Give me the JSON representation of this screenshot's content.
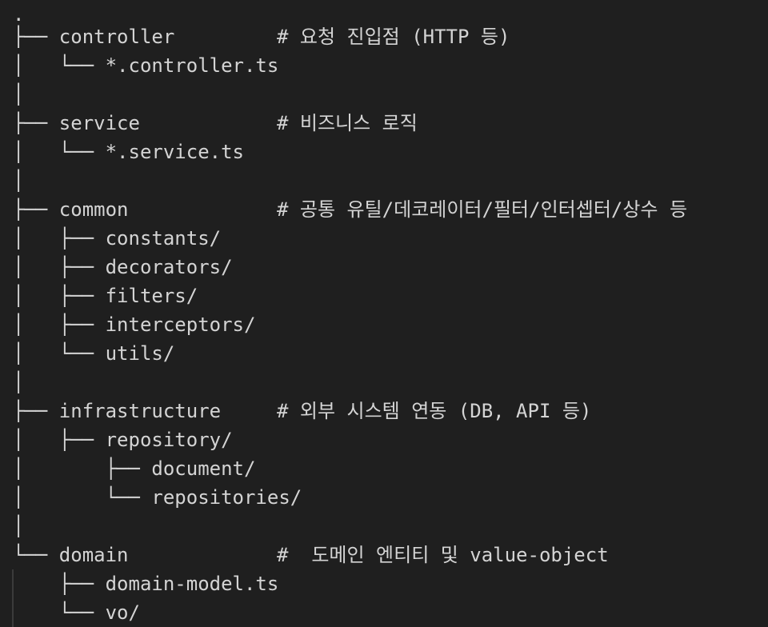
{
  "tree": {
    "root": ".",
    "lines": [
      {
        "prefix": "├── ",
        "name": "controller",
        "comment": "# 요청 진입점 (HTTP 등)"
      },
      {
        "prefix": "│   └── ",
        "name": "*.controller.ts",
        "comment": ""
      },
      {
        "prefix": "│",
        "name": "",
        "comment": ""
      },
      {
        "prefix": "├── ",
        "name": "service",
        "comment": "# 비즈니스 로직"
      },
      {
        "prefix": "│   └── ",
        "name": "*.service.ts",
        "comment": ""
      },
      {
        "prefix": "│",
        "name": "",
        "comment": ""
      },
      {
        "prefix": "├── ",
        "name": "common",
        "comment": "# 공통 유틸/데코레이터/필터/인터셉터/상수 등"
      },
      {
        "prefix": "│   ├── ",
        "name": "constants/",
        "comment": ""
      },
      {
        "prefix": "│   ├── ",
        "name": "decorators/",
        "comment": ""
      },
      {
        "prefix": "│   ├── ",
        "name": "filters/",
        "comment": ""
      },
      {
        "prefix": "│   ├── ",
        "name": "interceptors/",
        "comment": ""
      },
      {
        "prefix": "│   └── ",
        "name": "utils/",
        "comment": ""
      },
      {
        "prefix": "│",
        "name": "",
        "comment": ""
      },
      {
        "prefix": "├── ",
        "name": "infrastructure",
        "comment": "# 외부 시스템 연동 (DB, API 등)"
      },
      {
        "prefix": "│   ├── ",
        "name": "repository/",
        "comment": ""
      },
      {
        "prefix": "│       ├── ",
        "name": "document/",
        "comment": ""
      },
      {
        "prefix": "│       └── ",
        "name": "repositories/",
        "comment": ""
      },
      {
        "prefix": "│",
        "name": "",
        "comment": ""
      },
      {
        "prefix": "└── ",
        "name": "domain",
        "comment": "#  도메인 엔티티 및 value-object"
      },
      {
        "prefix": "    ├── ",
        "name": "domain-model.ts",
        "comment": ""
      },
      {
        "prefix": "    └── ",
        "name": "vo/",
        "comment": ""
      }
    ]
  },
  "colors": {
    "background": "#1f1f1f",
    "text": "#d4d4d4"
  }
}
